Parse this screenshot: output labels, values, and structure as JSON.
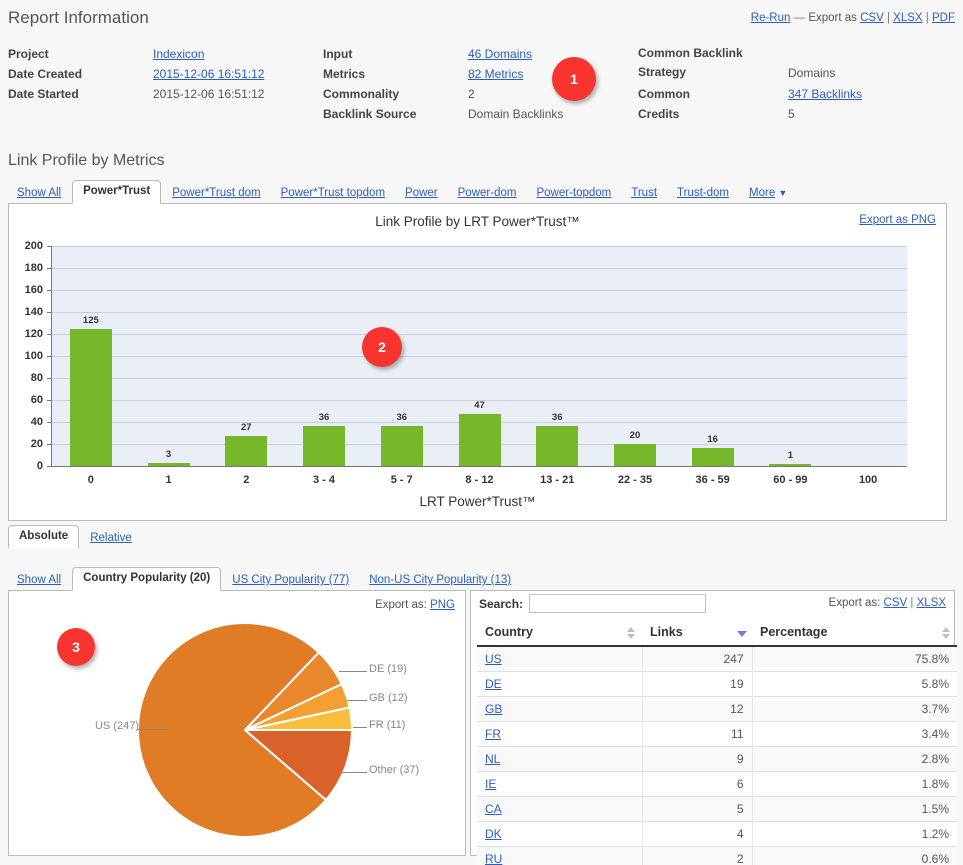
{
  "report": {
    "title": "Report Information",
    "actions": {
      "rerun": "Re-Run",
      "dash": "—",
      "export_as": "Export as",
      "csv": "CSV",
      "pipe1": "|",
      "xlsx": "XLSX",
      "pipe2": "|",
      "pdf": "PDF"
    },
    "col1": [
      {
        "label": "Project",
        "value": "Indexicon",
        "link": true
      },
      {
        "label": "Date Created",
        "value": "2015-12-06 16:51:12",
        "link": true
      },
      {
        "label": "Date Started",
        "value": "2015-12-06 16:51:12",
        "link": false
      }
    ],
    "col2": [
      {
        "label": "Input",
        "value": "46 Domains",
        "link": true
      },
      {
        "label": "Metrics",
        "value": "82 Metrics",
        "link": true
      },
      {
        "label": "Commonality",
        "value": "2",
        "link": false
      },
      {
        "label": "Backlink Source",
        "value": "Domain Backlinks",
        "link": false
      }
    ],
    "col3": [
      {
        "label": "Common Backlink Strategy",
        "value": "Domains",
        "link": false
      },
      {
        "label": "Common",
        "value": "347 Backlinks",
        "link": true
      },
      {
        "label": "Credits",
        "value": "5",
        "link": false
      }
    ]
  },
  "metrics_section": {
    "heading": "Link Profile by Metrics",
    "tabs": [
      {
        "label": "Show All",
        "active": false
      },
      {
        "label": "Power*Trust",
        "active": true
      },
      {
        "label": "Power*Trust dom",
        "active": false
      },
      {
        "label": "Power*Trust topdom",
        "active": false
      },
      {
        "label": "Power",
        "active": false
      },
      {
        "label": "Power-dom",
        "active": false
      },
      {
        "label": "Power-topdom",
        "active": false
      },
      {
        "label": "Trust",
        "active": false
      },
      {
        "label": "Trust-dom",
        "active": false
      },
      {
        "label": "More",
        "active": false,
        "caret": "▼"
      }
    ],
    "export_png": "Export as PNG",
    "scale_tabs": [
      {
        "label": "Absolute",
        "active": true
      },
      {
        "label": "Relative",
        "active": false
      }
    ]
  },
  "popularity_section": {
    "tabs": [
      {
        "label": "Show All",
        "active": false
      },
      {
        "label": "Country Popularity (20)",
        "active": true
      },
      {
        "label": "US City Popularity (77)",
        "active": false
      },
      {
        "label": "Non-US City Popularity (13)",
        "active": false
      }
    ],
    "pie_export_prefix": "Export as:",
    "pie_export_png": "PNG",
    "search_label": "Search:",
    "search_value": "",
    "search_placeholder": "",
    "table_export_prefix": "Export as:",
    "table_export_csv": "CSV",
    "table_export_pipe": "|",
    "table_export_xlsx": "XLSX",
    "columns": [
      {
        "label": "Country",
        "sort": "both"
      },
      {
        "label": "Links",
        "sort": "desc"
      },
      {
        "label": "Percentage",
        "sort": "both"
      }
    ],
    "rows": [
      {
        "country": "US",
        "links": "247",
        "percentage": "75.8%"
      },
      {
        "country": "DE",
        "links": "19",
        "percentage": "5.8%"
      },
      {
        "country": "GB",
        "links": "12",
        "percentage": "3.7%"
      },
      {
        "country": "FR",
        "links": "11",
        "percentage": "3.4%"
      },
      {
        "country": "NL",
        "links": "9",
        "percentage": "2.8%"
      },
      {
        "country": "IE",
        "links": "6",
        "percentage": "1.8%"
      },
      {
        "country": "CA",
        "links": "5",
        "percentage": "1.5%"
      },
      {
        "country": "DK",
        "links": "4",
        "percentage": "1.2%"
      },
      {
        "country": "RU",
        "links": "2",
        "percentage": "0.6%"
      }
    ]
  },
  "markers": [
    {
      "number": "1",
      "color": "#f7352e"
    },
    {
      "number": "2",
      "color": "#f7352e"
    },
    {
      "number": "3",
      "color": "#f7352e"
    }
  ],
  "chart_data": [
    {
      "type": "bar",
      "title": "Link Profile by LRT Power*Trust™",
      "xlabel": "LRT Power*Trust™",
      "ylabel": "",
      "ylim": [
        0,
        200
      ],
      "yticks": [
        0,
        20,
        40,
        60,
        80,
        100,
        120,
        140,
        160,
        180,
        200
      ],
      "grid": true,
      "legend": "none",
      "categories": [
        "0",
        "1",
        "2",
        "3 - 4",
        "5 - 7",
        "8 - 12",
        "13 - 21",
        "22 - 35",
        "36 - 59",
        "60 - 99",
        "100"
      ],
      "values": [
        125,
        3,
        27,
        36,
        36,
        47,
        36,
        20,
        16,
        1,
        0
      ],
      "bar_color": "#76b82a",
      "plot_background": "#eaeef6"
    },
    {
      "type": "pie",
      "title": "",
      "labels": [
        "US",
        "DE",
        "GB",
        "FR",
        "Other"
      ],
      "values": [
        247,
        19,
        12,
        11,
        37
      ],
      "display_labels": [
        "US (247)",
        "DE (19)",
        "GB (12)",
        "FR (11)",
        "Other (37)"
      ],
      "colors": [
        "#e07b26",
        "#e8872b",
        "#f2a033",
        "#fbbe3c",
        "#d9622b"
      ],
      "legend": "leader-lines"
    }
  ]
}
